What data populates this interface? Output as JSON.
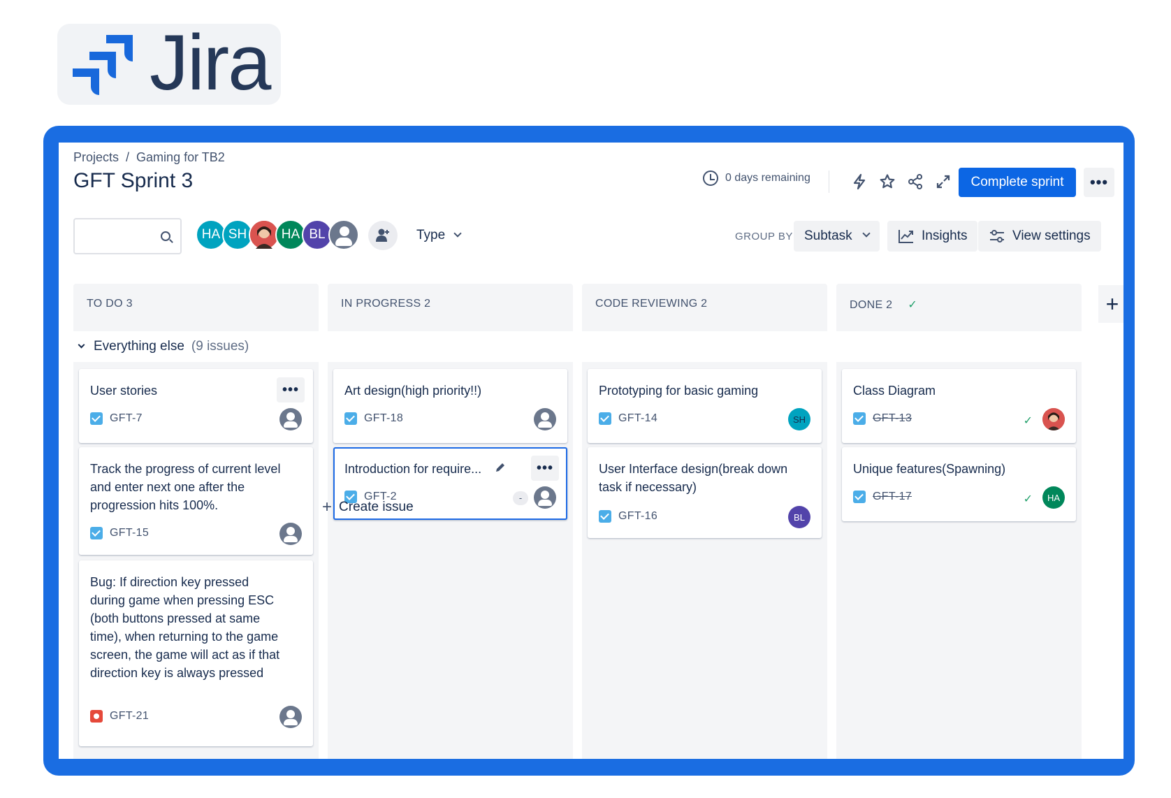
{
  "logo": {
    "text": "Jira",
    "icon": "jira-logo-icon"
  },
  "header": {
    "breadcrumb": {
      "projects": "Projects",
      "separator": "/",
      "project": "Gaming for TB2"
    },
    "title": "GFT Sprint 3",
    "days_remaining": "0 days remaining",
    "complete_label": "Complete sprint",
    "more": "•••"
  },
  "toolbar": {
    "search_placeholder": "",
    "avatars": [
      {
        "initials": "HA",
        "color": "#00a3bf"
      },
      {
        "initials": "SH",
        "color": "#00a3bf"
      },
      {
        "initials": "",
        "color": "#c1453a"
      },
      {
        "initials": "HA",
        "color": "#00875a"
      },
      {
        "initials": "BL",
        "color": "#5243aa"
      },
      {
        "initials": "",
        "color": "#6b778c"
      }
    ],
    "type_label": "Type",
    "group_by_label": "GROUP BY",
    "group_by_value": "Subtask",
    "insights_label": "Insights",
    "view_settings_label": "View settings"
  },
  "columns": [
    {
      "title": "TO DO 3"
    },
    {
      "title": "IN PROGRESS 2"
    },
    {
      "title": "CODE REVIEWING 2"
    },
    {
      "title": "DONE 2",
      "done_check": "✓"
    }
  ],
  "swimlane": {
    "label": "Everything else",
    "count": "(9 issues)"
  },
  "cards": {
    "c1": {
      "title": "User stories",
      "key": "GFT-7",
      "more": "•••"
    },
    "c2": {
      "title": "Track the progress of current level and enter next one after the progression hits 100%.",
      "key": "GFT-15"
    },
    "c3": {
      "title": "Bug: If direction key pressed during game when pressing ESC (both buttons pressed at same time), when returning to the game screen, the game will act as if that direction key is always pressed",
      "key": "GFT-21"
    },
    "c4": {
      "title": "Art design(high priority!!)",
      "key": "GFT-18"
    },
    "c5": {
      "title": "Introduction for require...",
      "key": "GFT-2",
      "estimate": "-",
      "more": "•••"
    },
    "c6": {
      "title": "Prototyping for basic gaming",
      "key": "GFT-14",
      "assignee": "SH"
    },
    "c7": {
      "title": "User Interface design(break down task if necessary)",
      "key": "GFT-16",
      "assignee": "BL"
    },
    "c8": {
      "title": "Class Diagram",
      "key": "GFT-13",
      "done": "✓"
    },
    "c9": {
      "title": "Unique features(Spawning)",
      "key": "GFT-17",
      "assignee": "HA",
      "done": "✓"
    }
  },
  "create_issue": "Create issue",
  "colors": {
    "frame": "#1a6de2",
    "primary": "#0c66e4",
    "story": "#4bade8",
    "bug": "#e5493a"
  }
}
